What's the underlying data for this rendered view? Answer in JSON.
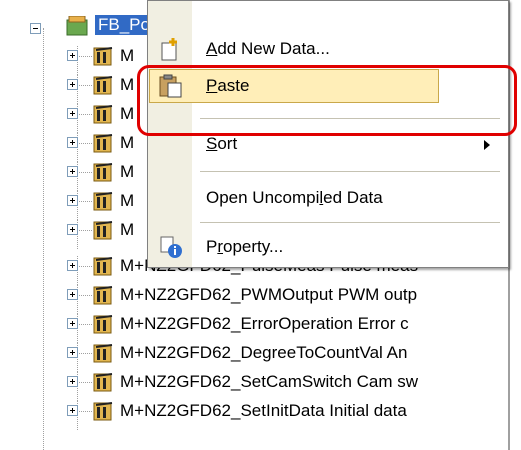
{
  "tree": {
    "root_label": "FB_Pool",
    "items": [
      {
        "label": "M+NZ2GFD62_PulseMeas Pulse meas"
      },
      {
        "label": "M+NZ2GFD62_PWMOutput PWM outp"
      },
      {
        "label": "M+NZ2GFD62_ErrorOperation Error c"
      },
      {
        "label": "M+NZ2GFD62_DegreeToCountVal An"
      },
      {
        "label": "M+NZ2GFD62_SetCamSwitch Cam sw"
      },
      {
        "label": "M+NZ2GFD62_SetInitData Initial data"
      }
    ],
    "hidden_row_prefix": "M"
  },
  "context_menu": {
    "items": [
      {
        "label_pre": "",
        "mnemonic": "A",
        "label_post": "dd New Data...",
        "icon": "add-data-icon"
      },
      {
        "label_pre": "",
        "mnemonic": "P",
        "label_post": "aste",
        "icon": "paste-icon"
      },
      {
        "label_pre": "",
        "mnemonic": "S",
        "label_post": "ort",
        "icon": ""
      },
      {
        "label_pre": "Open Uncompi",
        "mnemonic": "l",
        "label_post": "ed Data",
        "icon": ""
      },
      {
        "label_pre": "P",
        "mnemonic": "r",
        "label_post": "operty...",
        "icon": "property-icon"
      }
    ]
  },
  "colors": {
    "selection": "#316ac5",
    "highlight": "#ffeeb8",
    "callout": "#e00000"
  }
}
